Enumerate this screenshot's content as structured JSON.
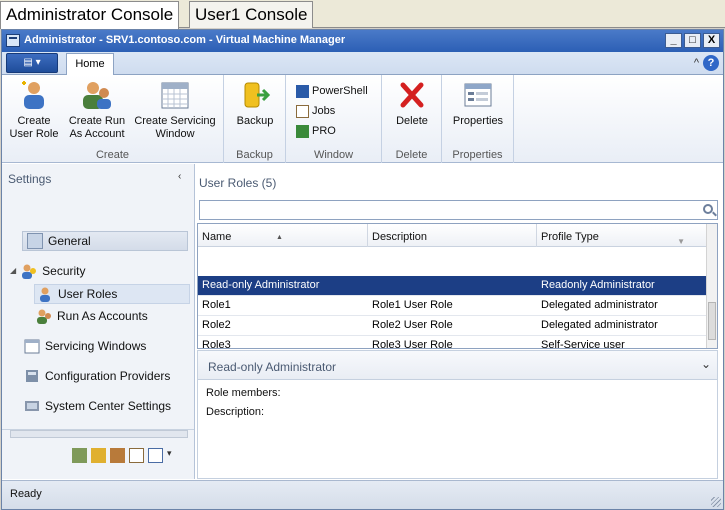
{
  "outer_tabs": [
    "Administrator Console",
    "User1 Console"
  ],
  "window": {
    "title": "Administrator - SRV1.contoso.com - Virtual Machine Manager",
    "min_label": "_",
    "max_label": "□",
    "close_label": "X"
  },
  "ribbon": {
    "app_button_label": "▤ ▾",
    "home_tab": "Home",
    "help_up": "^",
    "help_label": "?",
    "groups": {
      "create": {
        "label": "Create",
        "create_user_role": "Create\nUser Role",
        "create_run_as": "Create Run\nAs Account",
        "create_servicing": "Create Servicing\nWindow"
      },
      "backup": {
        "label": "Backup",
        "backup": "Backup"
      },
      "window": {
        "label": "Window",
        "powershell": "PowerShell",
        "jobs": "Jobs",
        "pro": "PRO"
      },
      "delete": {
        "label": "Delete",
        "delete": "Delete"
      },
      "properties": {
        "label": "Properties",
        "properties": "Properties"
      }
    }
  },
  "left_pane": {
    "header": "Settings",
    "collapse": "‹",
    "items": {
      "general": "General",
      "security": "Security",
      "user_roles": "User Roles",
      "run_as_accounts": "Run As Accounts",
      "servicing_windows": "Servicing Windows",
      "configuration_providers": "Configuration Providers",
      "system_center_settings": "System Center Settings"
    },
    "expand_arrow": "◢",
    "tools_more": "▾"
  },
  "main": {
    "title": "User Roles (5)",
    "search_placeholder": "",
    "columns": [
      "Name",
      "Description",
      "Profile Type"
    ],
    "rows": [
      {
        "name": "Read-only Administrator",
        "description": "",
        "profile": "Readonly Administrator"
      },
      {
        "name": "Role1",
        "description": "Role1 User Role",
        "profile": "Delegated administrator"
      },
      {
        "name": "Role2",
        "description": "Role2 User Role",
        "profile": "Delegated administrator"
      },
      {
        "name": "Role3",
        "description": "Role3 User Role",
        "profile": "Self-Service user"
      }
    ],
    "detail_title": "Read-only Administrator",
    "detail_chevron": "⌄",
    "role_members_label": "Role members:",
    "description_label": "Description:"
  },
  "status": {
    "text": "Ready"
  },
  "colors": {
    "selected_row": "#1c3e85",
    "titlebar": "#2c5fb5"
  }
}
